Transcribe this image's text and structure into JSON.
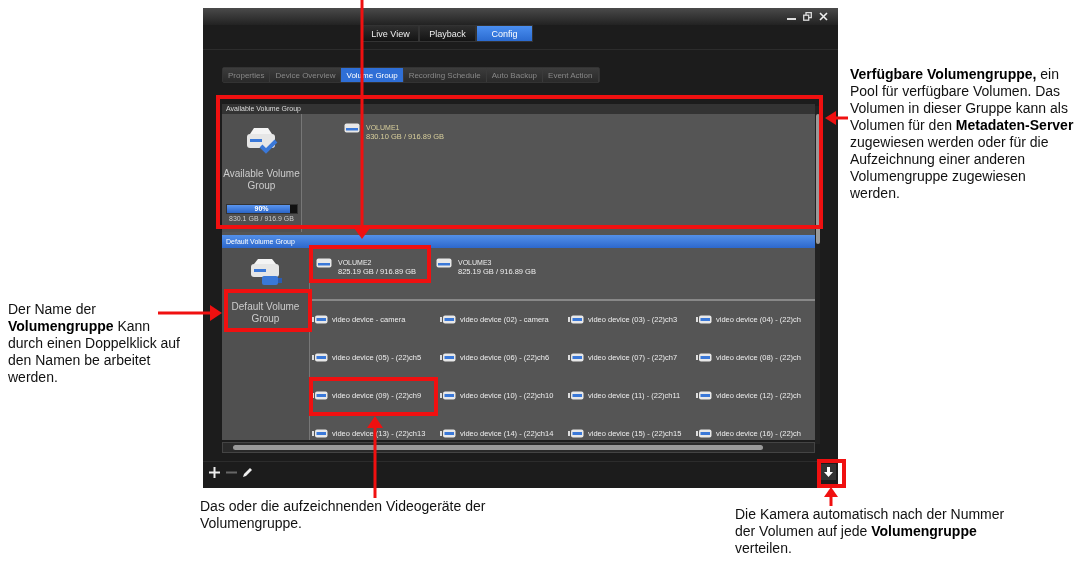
{
  "main_tabs": [
    {
      "label": "Live View",
      "selected": false
    },
    {
      "label": "Playback",
      "selected": false
    },
    {
      "label": "Config",
      "selected": true
    }
  ],
  "sub_tabs": [
    {
      "label": "Properties",
      "selected": false
    },
    {
      "label": "Device Overview",
      "selected": false
    },
    {
      "label": "Volume Group",
      "selected": true
    },
    {
      "label": "Recording Schedule",
      "selected": false
    },
    {
      "label": "Auto Backup",
      "selected": false
    },
    {
      "label": "Event Action",
      "selected": false
    }
  ],
  "available_group": {
    "header": "Available Volume Group",
    "name": "Available Volume Group",
    "usage": {
      "level": 0.9,
      "reading": "90%"
    },
    "capacity": "830.1 GB / 916.9 GB",
    "volumes": [
      {
        "name": "VOLUME1",
        "size": "830.10 GB / 916.89 GB"
      }
    ]
  },
  "default_group": {
    "header": "Default Volume Group",
    "name": "Default Volume Group",
    "volumes": [
      {
        "name": "VOLUME2",
        "size": "825.19 GB / 916.89 GB"
      },
      {
        "name": "VOLUME3",
        "size": "825.19 GB / 916.89 GB"
      }
    ],
    "devices": [
      "video device - camera",
      "video device (02) - camera",
      "video device (03) - (22)ch3",
      "video device (04) - (22)ch",
      "video device (05) - (22)ch5",
      "video device (06) - (22)ch6",
      "video device (07) - (22)ch7",
      "video device (08) - (22)ch",
      "video device (09) - (22)ch9",
      "video device (10) - (22)ch10",
      "video device (11) - (22)ch11",
      "video device (12) - (22)ch",
      "video device (13) - (22)ch13",
      "video device (14) - (22)ch14",
      "video device (15) - (22)ch15",
      "video device (16) - (22)ch"
    ]
  },
  "callouts": [
    {
      "text": "**Verfügbare Volumengruppe,** ein Pool für verfügbare Volumen. Das Volumen in dieser Gruppe kann als Volumen für den **Metadaten-Server** zugewiesen werden oder für die Aufzeichnung einer anderen Volumengruppe zugewiesen werden."
    },
    {
      "text": "Der Name der **Volumengruppe** Kann durch einen Doppelklick auf den Namen be arbeitet werden."
    },
    {
      "text": "Das oder die aufzeichnenden Videogeräte der Volumengruppe."
    },
    {
      "text": "Die Kamera automatisch nach der Nummer der Volumen auf jede **Volumengruppe** verteilen."
    }
  ]
}
